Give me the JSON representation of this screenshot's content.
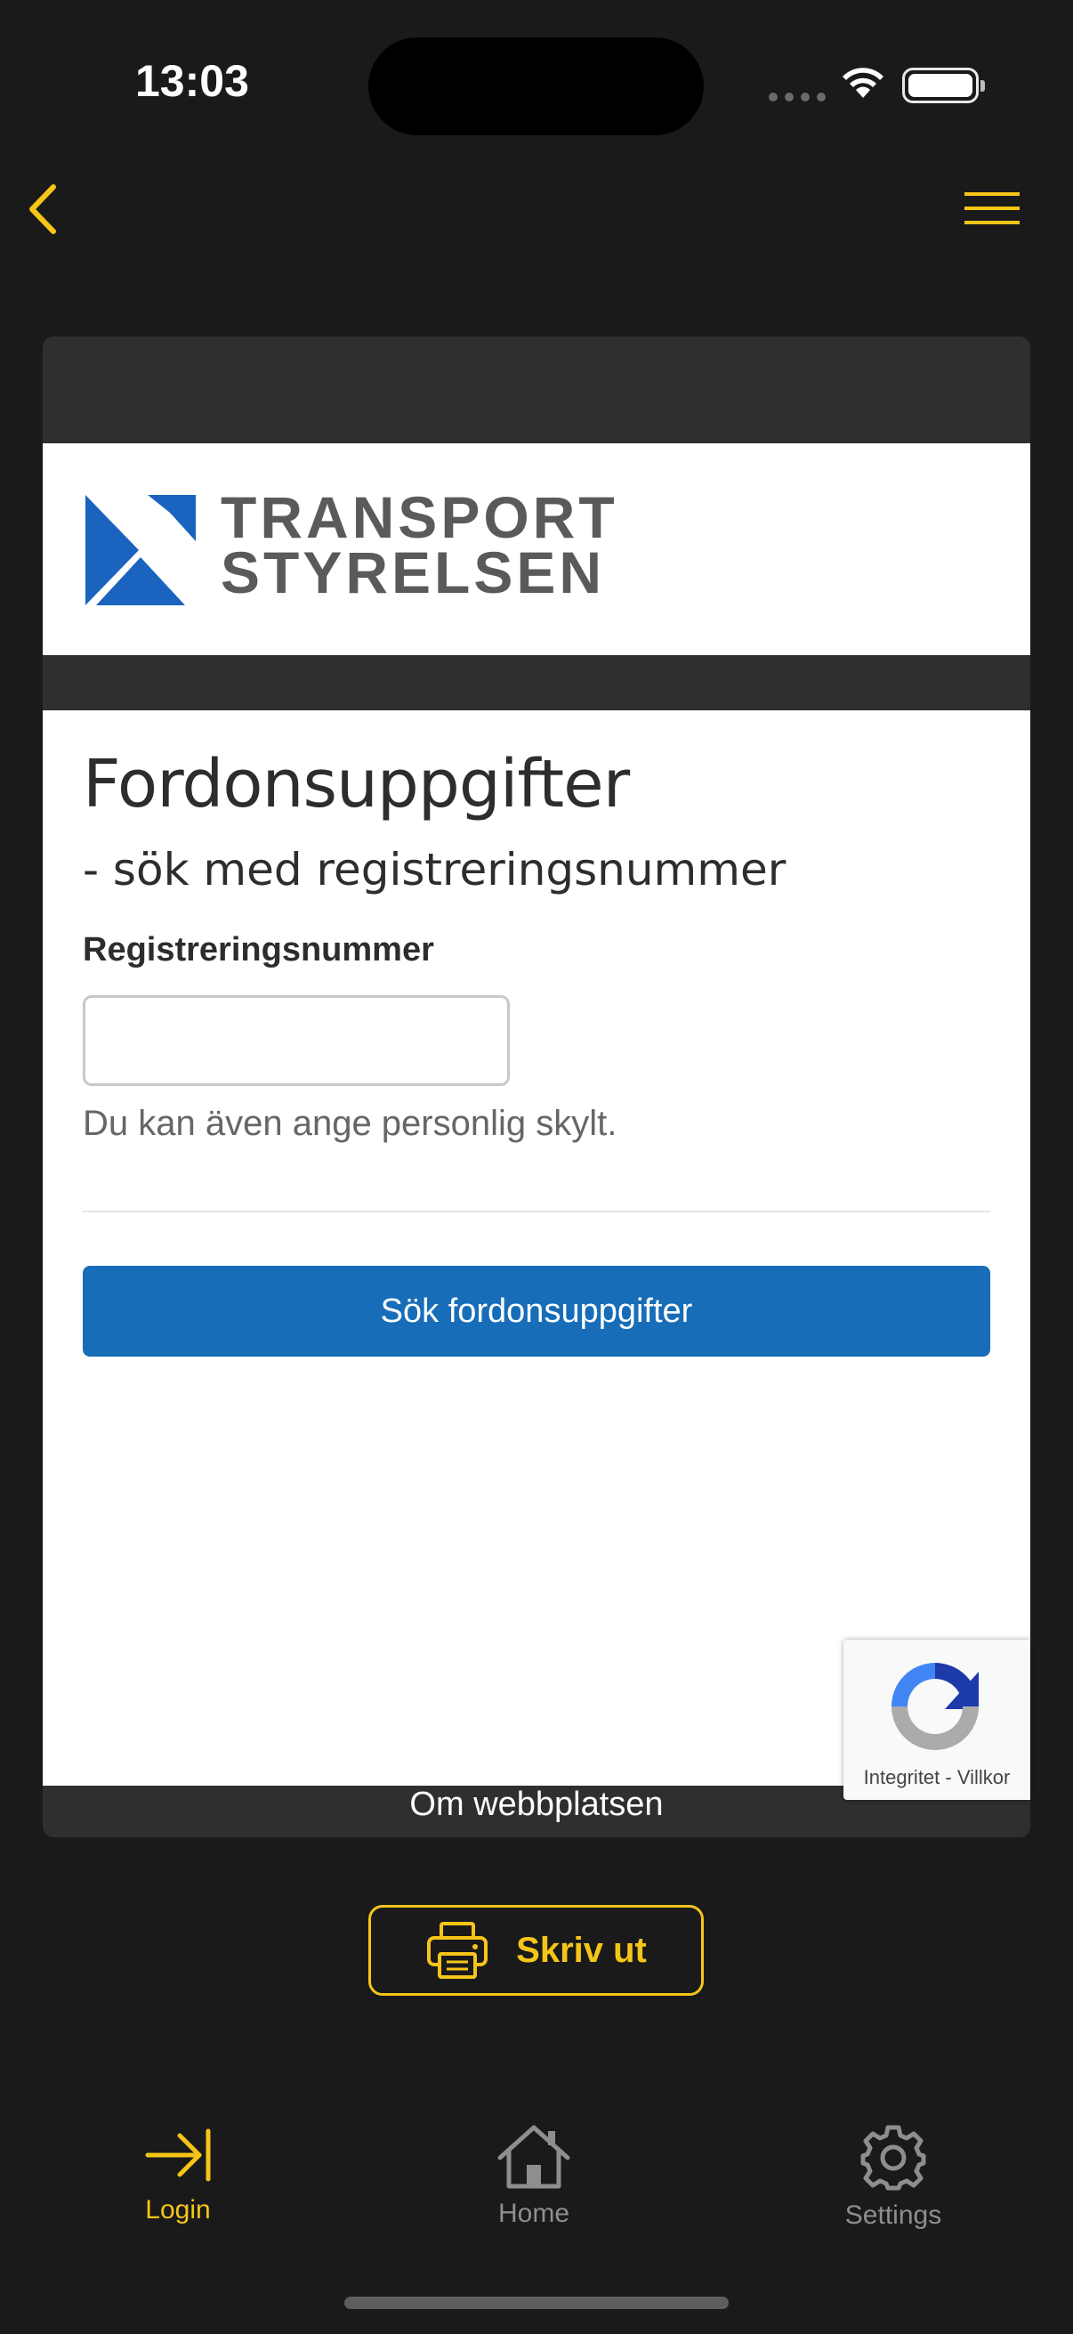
{
  "status_bar": {
    "time": "13:03"
  },
  "nav": {
    "back_icon": "chevron-left-icon",
    "menu_icon": "hamburger-menu-icon",
    "accent_color": "#f5c518"
  },
  "web_page": {
    "logo": {
      "line1": "TRANSPORT",
      "line2": "STYRELSEN"
    },
    "title": "Fordonsuppgifter",
    "subtitle": "- sök med registreringsnummer",
    "field_label": "Registreringsnummer",
    "input_value": "",
    "helper_text": "Du kan även ange personlig skylt.",
    "search_button": "Sök fordonsuppgifter",
    "footer_link": "Om webbplatsen",
    "button_color": "#176db8"
  },
  "recaptcha": {
    "links": "Integritet - Villkor"
  },
  "print": {
    "label": "Skriv ut",
    "icon": "printer-icon"
  },
  "tab_bar": {
    "items": [
      {
        "label": "Login",
        "icon": "login-arrow-icon",
        "active": true
      },
      {
        "label": "Home",
        "icon": "home-icon",
        "active": false
      },
      {
        "label": "Settings",
        "icon": "gear-icon",
        "active": false
      }
    ]
  }
}
